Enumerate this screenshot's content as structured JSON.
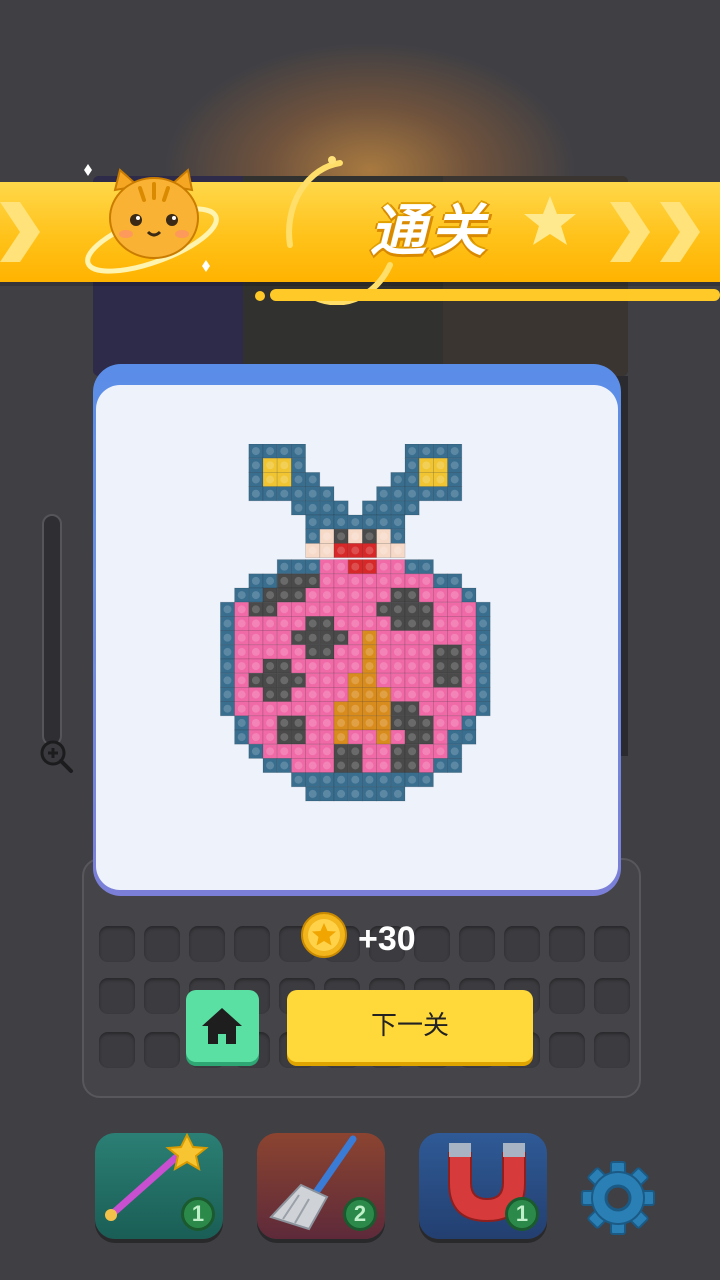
{
  "banner": {
    "title": "通关"
  },
  "reward": {
    "amount": "+30",
    "coin_icon": "star-coin-icon"
  },
  "buttons": {
    "home_icon": "home-icon",
    "next_label": "下一关"
  },
  "tools": [
    {
      "name": "magic-wand",
      "count": "1",
      "color": "#1f6b62"
    },
    {
      "name": "broom",
      "count": "2",
      "color": "#7a3b2f"
    },
    {
      "name": "magnet",
      "count": "1",
      "color": "#2a4f86"
    }
  ],
  "settings_icon": "gear-icon",
  "zoom_icon": "zoom-in-icon",
  "colors": {
    "banner": "#ffc21a",
    "popup_border": "#5a8de8",
    "home_button": "#5be0a4",
    "next_button": "#ffd93a",
    "ladybug_body": "#f06aa8",
    "ladybug_outline": "#3a6e8f",
    "ladybug_spots": "#4a4a4a",
    "ladybug_stripe": "#d98c1e"
  }
}
